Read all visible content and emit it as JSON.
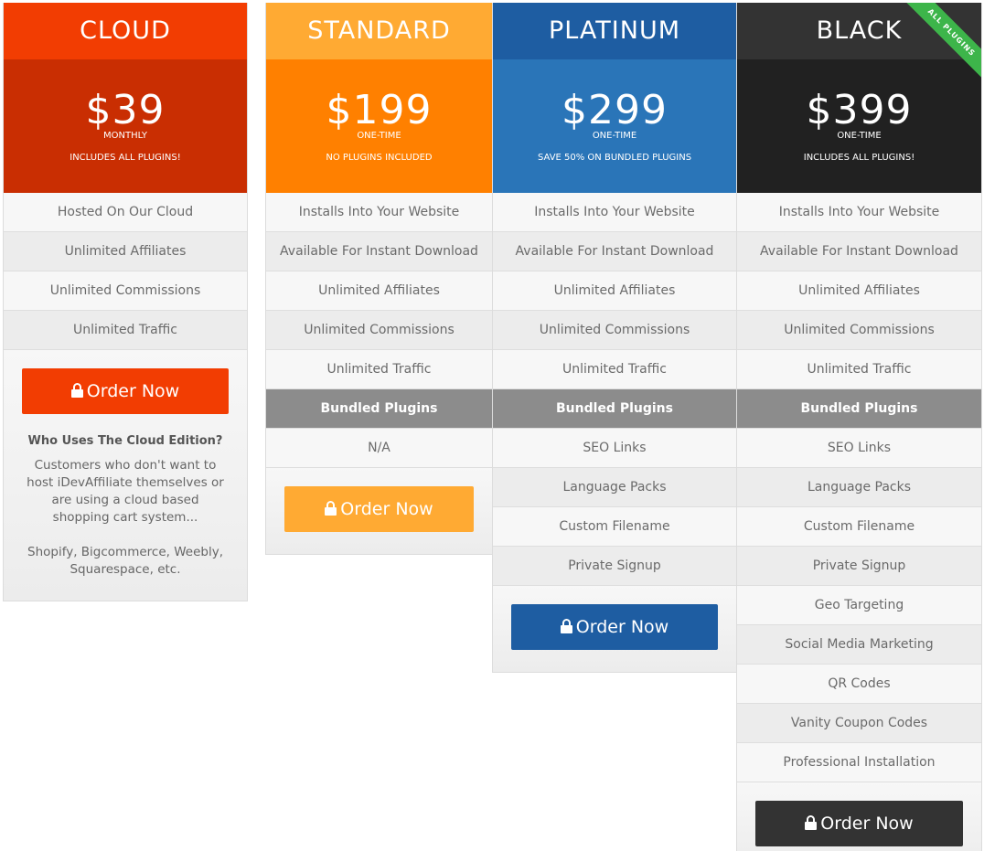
{
  "plans": {
    "cloud": {
      "name": "CLOUD",
      "price": "$39",
      "period": "MONTHLY",
      "note": "INCLUDES ALL PLUGINS!",
      "features": [
        "Hosted On Our Cloud",
        "Unlimited Affiliates",
        "Unlimited Commissions",
        "Unlimited Traffic"
      ],
      "button": "Order Now",
      "who_title": "Who Uses The Cloud Edition?",
      "who_text": "Customers who don't want to host iDevAffiliate themselves or are using a cloud based shopping cart system...",
      "who_examples": "Shopify, Bigcommerce, Weebly, Squarespace, etc."
    },
    "standard": {
      "name": "STANDARD",
      "price": "$199",
      "period": "ONE-TIME",
      "note": "NO PLUGINS INCLUDED",
      "features": [
        "Installs Into Your Website",
        "Available For Instant Download",
        "Unlimited Affiliates",
        "Unlimited Commissions",
        "Unlimited Traffic"
      ],
      "bundled_header": "Bundled Plugins",
      "plugins": [
        "N/A"
      ],
      "button": "Order Now"
    },
    "platinum": {
      "name": "PLATINUM",
      "price": "$299",
      "period": "ONE-TIME",
      "note": "SAVE 50% ON BUNDLED PLUGINS",
      "features": [
        "Installs Into Your Website",
        "Available For Instant Download",
        "Unlimited Affiliates",
        "Unlimited Commissions",
        "Unlimited Traffic"
      ],
      "bundled_header": "Bundled Plugins",
      "plugins": [
        "SEO Links",
        "Language Packs",
        "Custom Filename",
        "Private Signup"
      ],
      "button": "Order Now"
    },
    "black": {
      "name": "BLACK",
      "price": "$399",
      "period": "ONE-TIME",
      "note": "INCLUDES ALL PLUGINS!",
      "ribbon": "ALL PLUGINS",
      "features": [
        "Installs Into Your Website",
        "Available For Instant Download",
        "Unlimited Affiliates",
        "Unlimited Commissions",
        "Unlimited Traffic"
      ],
      "bundled_header": "Bundled Plugins",
      "plugins": [
        "SEO Links",
        "Language Packs",
        "Custom Filename",
        "Private Signup",
        "Geo Targeting",
        "Social Media Marketing",
        "QR Codes",
        "Vanity Coupon Codes",
        "Professional Installation"
      ],
      "button": "Order Now"
    }
  },
  "colors": {
    "cloud": "#f23d02",
    "standard": "#ff8000",
    "platinum": "#1e5da2",
    "black": "#212121",
    "ribbon": "#3db54a"
  },
  "icons": {
    "button": "lock-icon"
  }
}
